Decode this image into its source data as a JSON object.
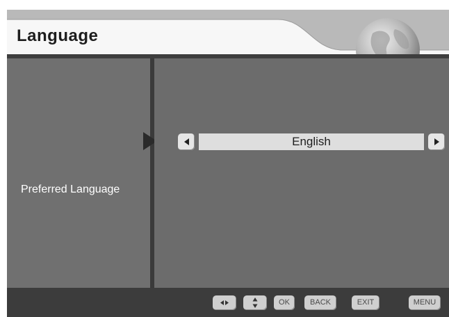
{
  "header": {
    "title": "Language",
    "globe_icon": "globe-icon"
  },
  "settings": {
    "preferred_language_label": "Preferred Language",
    "language_value": "English",
    "prev_icon": "triangle-left-icon",
    "next_icon": "triangle-right-icon"
  },
  "footer": {
    "lr_icon": "left-right-arrows-icon",
    "ud_icon": "up-down-arrows-icon",
    "ok_label": "OK",
    "back_label": "BACK",
    "exit_label": "EXIT",
    "menu_label": "MENU"
  },
  "colors": {
    "background": "#6a6a6a",
    "header": "#d3d3d3",
    "footer": "#3c3c3c",
    "value_bar": "#dedede"
  }
}
